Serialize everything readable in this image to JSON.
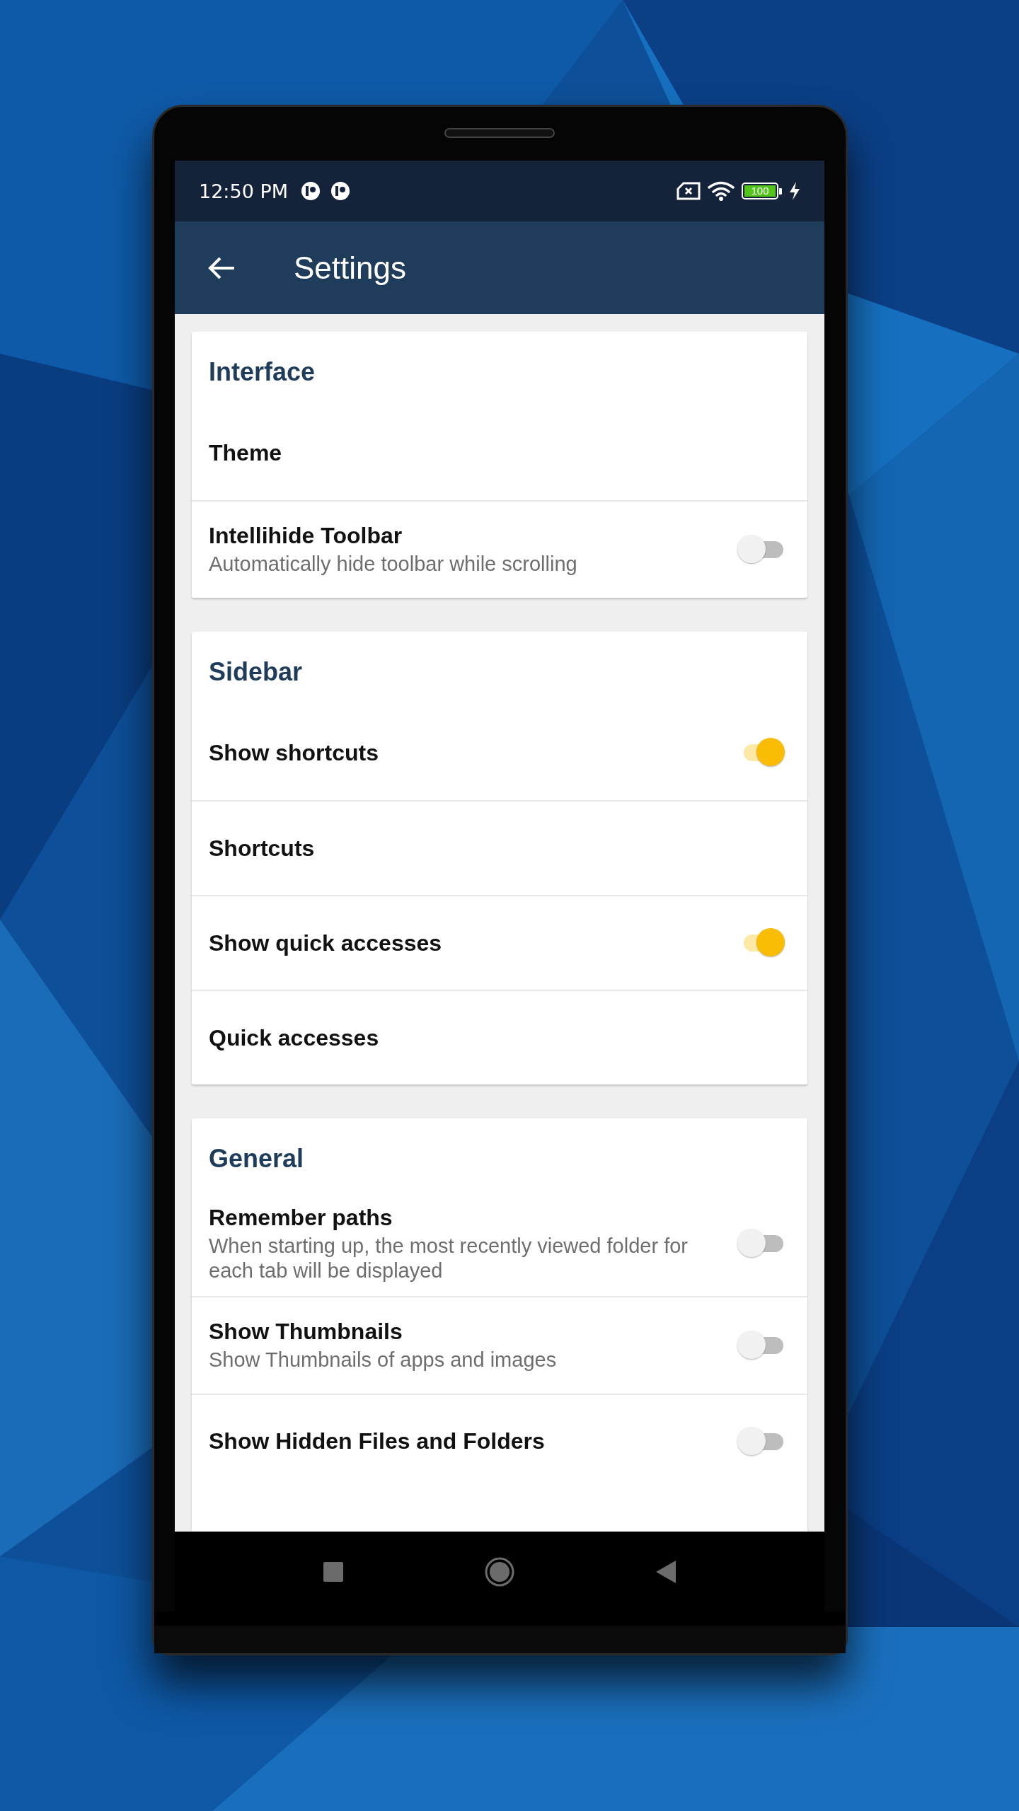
{
  "status_bar": {
    "time": "12:50 PM",
    "battery": "100"
  },
  "app_bar": {
    "title": "Settings"
  },
  "sections": [
    {
      "title": "Interface",
      "items": [
        {
          "kind": "link",
          "title": "Theme"
        },
        {
          "kind": "switch",
          "title": "Intellihide Toolbar",
          "subtitle": "Automatically hide toolbar while scrolling",
          "on": false
        }
      ]
    },
    {
      "title": "Sidebar",
      "items": [
        {
          "kind": "switch",
          "title": "Show shortcuts",
          "on": true
        },
        {
          "kind": "link",
          "title": "Shortcuts"
        },
        {
          "kind": "switch",
          "title": "Show quick accesses",
          "on": true
        },
        {
          "kind": "link",
          "title": "Quick accesses"
        }
      ]
    },
    {
      "title": "General",
      "items": [
        {
          "kind": "switch",
          "title": "Remember paths",
          "subtitle": "When starting up, the most recently viewed folder for each tab will be displayed",
          "on": false
        },
        {
          "kind": "switch",
          "title": "Show Thumbnails",
          "subtitle": "Show Thumbnails of apps and images",
          "on": false
        },
        {
          "kind": "switch",
          "title": "Show Hidden Files and Folders",
          "on": false
        }
      ]
    }
  ]
}
